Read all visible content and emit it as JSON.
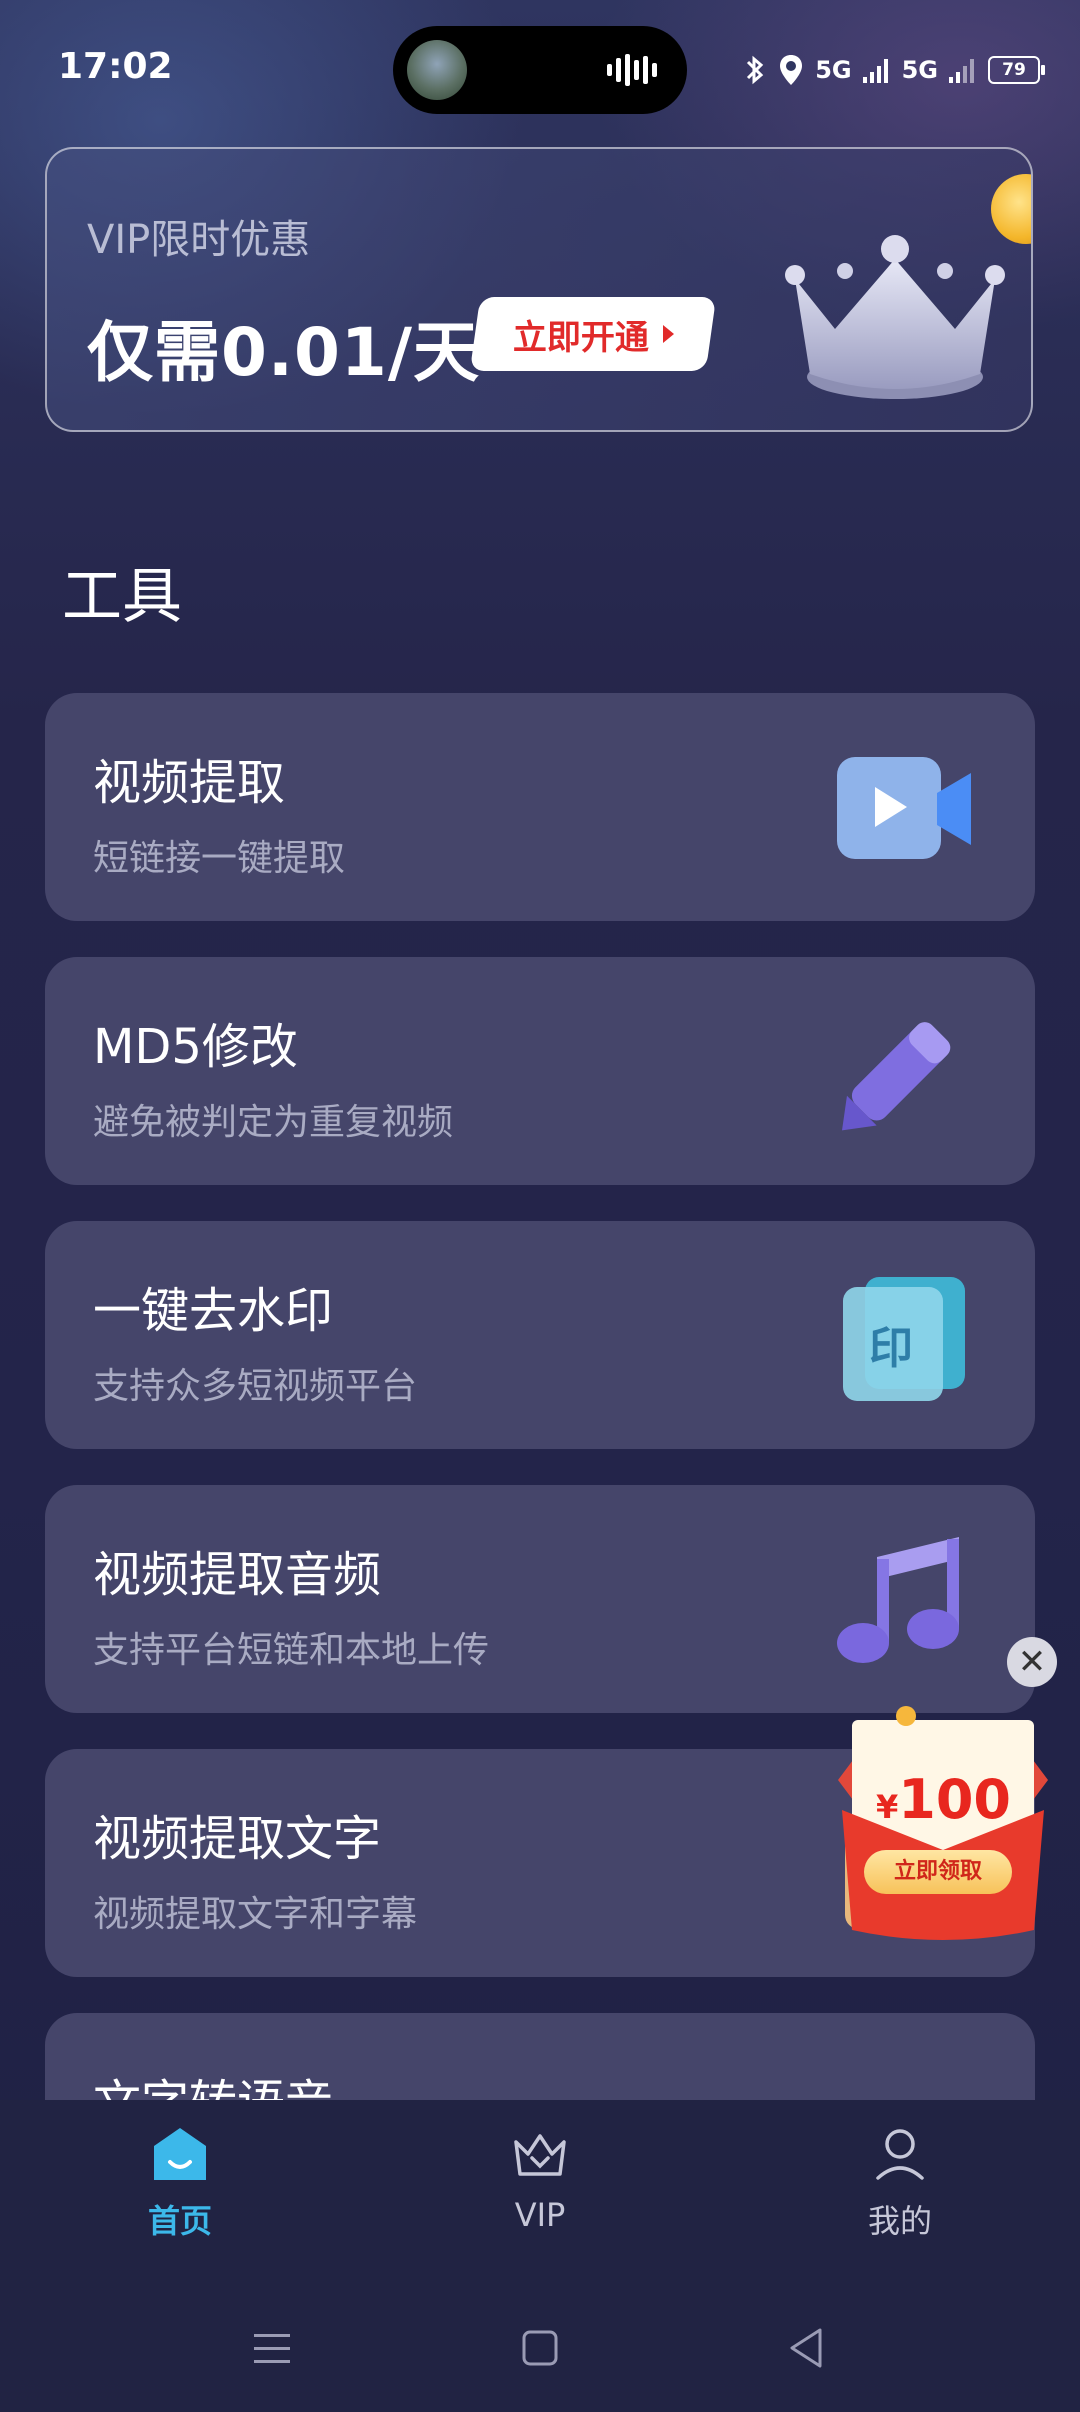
{
  "status_bar": {
    "time": "17:02",
    "network_1": "5G",
    "network_2": "5G",
    "battery": "79"
  },
  "vip_banner": {
    "subtitle": "VIP限时优惠",
    "price": "仅需0.01/天",
    "button_label": "立即开通"
  },
  "section": {
    "title": "工具"
  },
  "tools": [
    {
      "title": "视频提取",
      "desc": "短链接一键提取",
      "icon": "video-camera-icon"
    },
    {
      "title": "MD5修改",
      "desc": "避免被判定为重复视频",
      "icon": "pencil-icon"
    },
    {
      "title": "一键去水印",
      "desc": "支持众多短视频平台",
      "icon": "stamp-icon",
      "icon_text": "印"
    },
    {
      "title": "视频提取音频",
      "desc": "支持平台短链和本地上传",
      "icon": "music-note-icon"
    },
    {
      "title": "视频提取文字",
      "desc": "视频提取文字和字幕",
      "icon": "text-icon"
    },
    {
      "title": "文字转语音",
      "desc": "",
      "icon": "speech-icon"
    }
  ],
  "promo": {
    "amount": "100",
    "currency": "¥",
    "button_label": "立即领取",
    "close_symbol": "✕"
  },
  "tab_bar": {
    "tabs": [
      {
        "label": "首页",
        "icon": "home-icon",
        "active": true
      },
      {
        "label": "VIP",
        "icon": "crown-icon",
        "active": false
      },
      {
        "label": "我的",
        "icon": "profile-icon",
        "active": false
      }
    ]
  },
  "colors": {
    "accent": "#3cb8ea",
    "card_bg": "#45456a",
    "vip_button_text": "#e12a2a"
  }
}
